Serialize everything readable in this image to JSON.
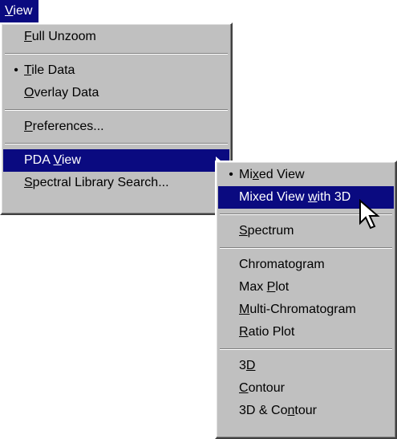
{
  "menubar": {
    "view": {
      "mnemonic": "V",
      "rest": "iew"
    }
  },
  "view_menu": {
    "full_unzoom": {
      "mnemonic": "F",
      "rest": "ull Unzoom"
    },
    "tile_data": {
      "bullet": "•",
      "mnemonic": "T",
      "rest": "ile Data"
    },
    "overlay_data": {
      "mnemonic": "O",
      "rest": "verlay Data"
    },
    "preferences": {
      "mnemonic": "P",
      "rest": "references..."
    },
    "pda_view": {
      "pre": "PDA ",
      "mnemonic": "V",
      "rest": "iew"
    },
    "spectral_library_search": {
      "mnemonic": "S",
      "rest": "pectral Library Search..."
    }
  },
  "pda_submenu": {
    "mixed_view": {
      "bullet": "•",
      "pre": "Mi",
      "mnemonic": "x",
      "rest": "ed View"
    },
    "mixed_view_3d": {
      "pre": "Mixed View ",
      "mnemonic": "w",
      "rest": "ith 3D"
    },
    "spectrum": {
      "mnemonic": "S",
      "rest": "pectrum"
    },
    "chromatogram": {
      "label": "Chromatogram"
    },
    "max_plot": {
      "pre": "Max ",
      "mnemonic": "P",
      "rest": "lot"
    },
    "multi_chromatogram": {
      "mnemonic": "M",
      "rest": "ulti-Chromatogram"
    },
    "ratio_plot": {
      "mnemonic": "R",
      "rest": "atio Plot"
    },
    "three_d": {
      "pre": "3",
      "mnemonic": "D",
      "rest": ""
    },
    "contour": {
      "mnemonic": "C",
      "rest": "ontour"
    },
    "three_d_contour": {
      "pre": "3D & Co",
      "mnemonic": "n",
      "rest": "tour"
    }
  },
  "colors": {
    "menu_bg": "#c0c0c0",
    "highlight": "#0a0a80",
    "highlight_text": "#ffffff"
  },
  "icons": {
    "submenu_arrow": "arrow-right-icon",
    "pointer": "mouse-cursor-icon"
  }
}
